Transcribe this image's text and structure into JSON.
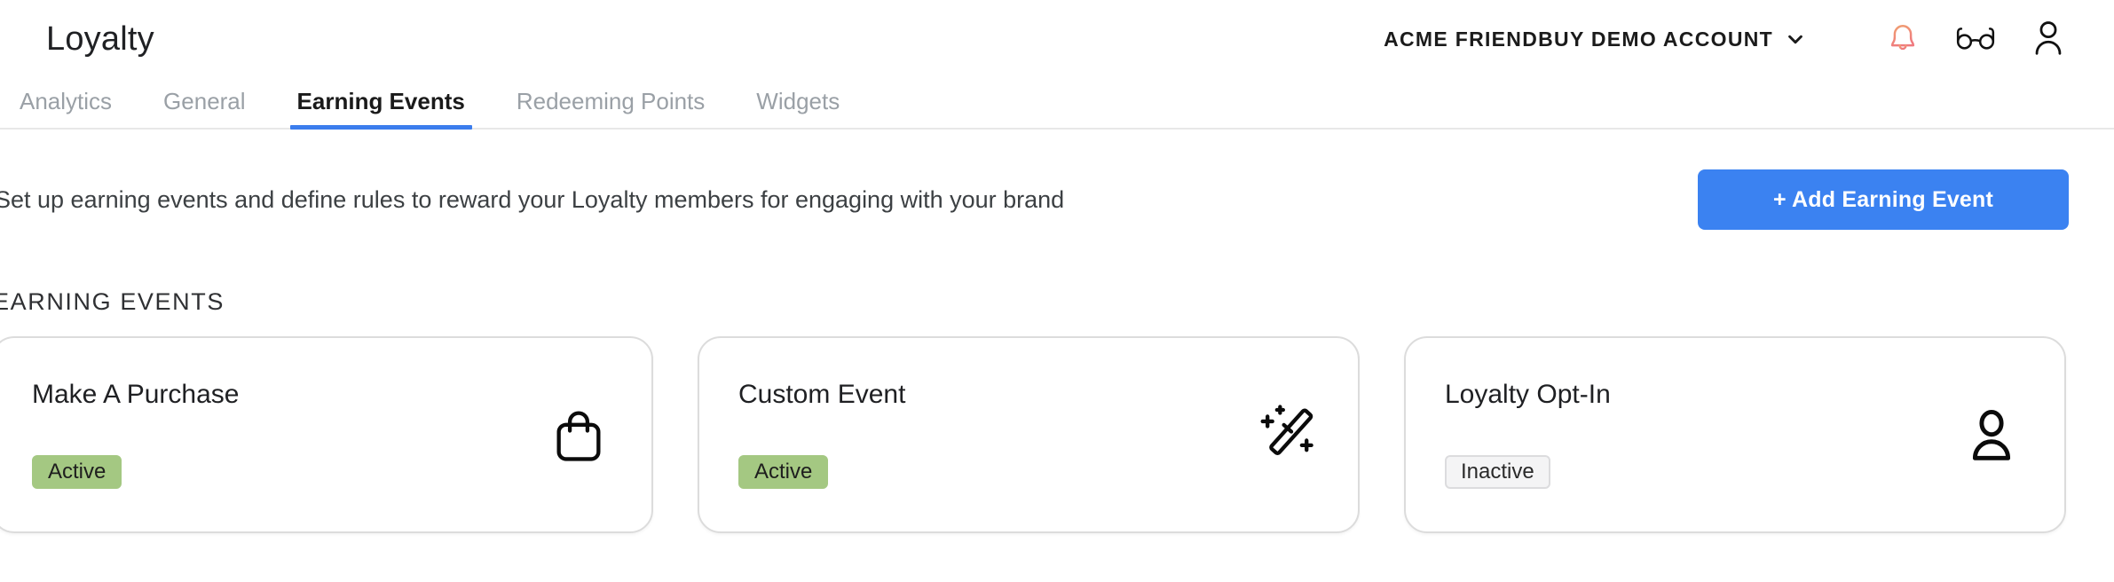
{
  "header": {
    "app_title": "Loyalty",
    "account_name": "ACME FRIENDBUY DEMO ACCOUNT",
    "account_chevron_icon": "chevron-down-icon",
    "notifications_icon": "bell-icon",
    "notifications_icon_color": "#ef8c7d",
    "preview_icon": "glasses-icon",
    "profile_icon": "user-icon"
  },
  "tabs": [
    {
      "label": "Analytics",
      "active": false
    },
    {
      "label": "General",
      "active": false
    },
    {
      "label": "Earning Events",
      "active": true
    },
    {
      "label": "Redeeming Points",
      "active": false
    },
    {
      "label": "Widgets",
      "active": false
    }
  ],
  "tab_indicator_color": "#3b7ded",
  "toolbar": {
    "description": "Set up earning events and define rules to reward your Loyalty members for engaging with your brand",
    "add_button_label": "+ Add Earning Event",
    "add_button_color": "#3b82f1"
  },
  "section": {
    "label": "EARNING EVENTS"
  },
  "cards": [
    {
      "title": "Make A Purchase",
      "status": "Active",
      "status_state": "active",
      "status_color": "#a4c882",
      "icon": "shopping-bag-icon"
    },
    {
      "title": "Custom Event",
      "status": "Active",
      "status_state": "active",
      "status_color": "#a4c882",
      "icon": "magic-wand-icon"
    },
    {
      "title": "Loyalty Opt-In",
      "status": "Inactive",
      "status_state": "inactive",
      "status_color": "#f4f4f5",
      "icon": "user-icon"
    }
  ]
}
